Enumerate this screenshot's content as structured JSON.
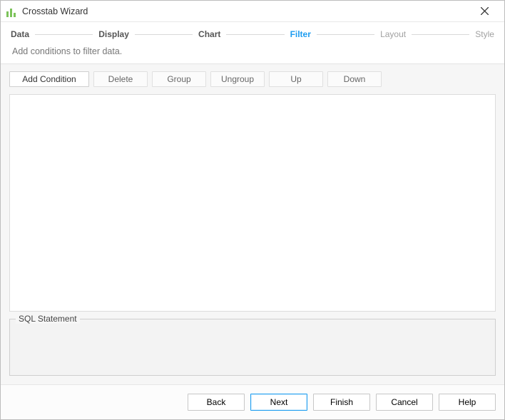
{
  "window": {
    "title": "Crosstab Wizard"
  },
  "steps": {
    "items": [
      {
        "label": "Data",
        "state": "past"
      },
      {
        "label": "Display",
        "state": "past"
      },
      {
        "label": "Chart",
        "state": "past"
      },
      {
        "label": "Filter",
        "state": "current"
      },
      {
        "label": "Layout",
        "state": "future"
      },
      {
        "label": "Style",
        "state": "future"
      }
    ],
    "description": "Add conditions to filter data."
  },
  "toolbar": {
    "addCondition": "Add Condition",
    "delete": "Delete",
    "group": "Group",
    "ungroup": "Ungroup",
    "up": "Up",
    "down": "Down"
  },
  "sql": {
    "label": "SQL Statement",
    "text": ""
  },
  "footer": {
    "back": "Back",
    "next": "Next",
    "finish": "Finish",
    "cancel": "Cancel",
    "help": "Help"
  }
}
